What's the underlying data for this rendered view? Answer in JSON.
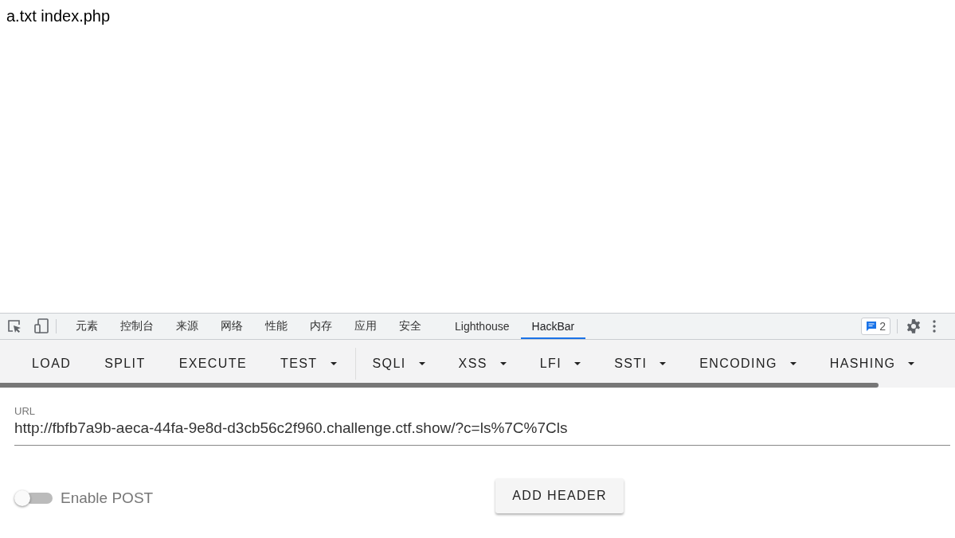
{
  "page": {
    "text": "a.txt index.php"
  },
  "devtools": {
    "tabs": [
      {
        "label": "元素",
        "selected": false
      },
      {
        "label": "控制台",
        "selected": false
      },
      {
        "label": "来源",
        "selected": false
      },
      {
        "label": "网络",
        "selected": false
      },
      {
        "label": "性能",
        "selected": false
      },
      {
        "label": "内存",
        "selected": false
      },
      {
        "label": "应用",
        "selected": false
      },
      {
        "label": "安全",
        "selected": false
      },
      {
        "label": "Lighthouse",
        "selected": false
      },
      {
        "label": "HackBar",
        "selected": true
      }
    ],
    "issues_count": "2"
  },
  "hackbar": {
    "menu": [
      {
        "label": "LOAD",
        "dropdown": false
      },
      {
        "label": "SPLIT",
        "dropdown": false
      },
      {
        "label": "EXECUTE",
        "dropdown": false
      },
      {
        "label": "TEST",
        "dropdown": true
      },
      {
        "label": "SQLI",
        "dropdown": true
      },
      {
        "label": "XSS",
        "dropdown": true
      },
      {
        "label": "LFI",
        "dropdown": true
      },
      {
        "label": "SSTI",
        "dropdown": true
      },
      {
        "label": "ENCODING",
        "dropdown": true
      },
      {
        "label": "HASHING",
        "dropdown": true
      }
    ],
    "url": {
      "label": "URL",
      "value": "http://fbfb7a9b-aeca-44fa-9e8d-d3cb56c2f960.challenge.ctf.show/?c=ls%7C%7Cls"
    },
    "enable_post": {
      "label": "Enable POST",
      "on": false
    },
    "add_header": "ADD HEADER"
  }
}
